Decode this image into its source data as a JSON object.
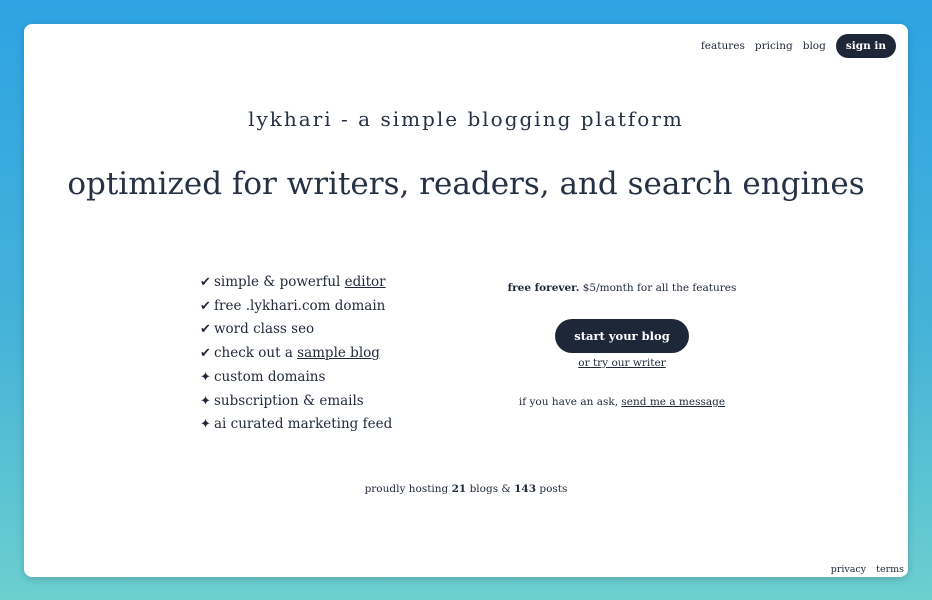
{
  "nav": {
    "items": [
      "features",
      "pricing",
      "blog"
    ],
    "signin_label": "sign in"
  },
  "hero": {
    "site_title": "lykhari - a simple blogging platform",
    "tagline": "optimized for writers, readers, and search engines"
  },
  "features": {
    "check_mark": "✔",
    "star_mark": "✦",
    "items": [
      {
        "text": "simple & powerful ",
        "link": "editor"
      },
      {
        "text": "free .lykhari.com domain"
      },
      {
        "text": "word class seo"
      },
      {
        "text": "check out a ",
        "link": "sample blog"
      },
      {
        "text": "custom domains"
      },
      {
        "text": "subscription & emails"
      },
      {
        "text": "ai curated marketing feed"
      }
    ]
  },
  "cta": {
    "pricing_bold": "free forever.",
    "pricing_rest": " $5/month for all the features",
    "start_button": "start your blog",
    "try_writer": "or try our writer",
    "ask_prefix": "if you have an ask, ",
    "ask_link": "send me a message"
  },
  "stats": {
    "prefix": "proudly hosting ",
    "blogs": "21",
    "middle": " blogs & ",
    "posts": "143",
    "suffix": " posts"
  },
  "footer": {
    "privacy": "privacy",
    "terms": "terms"
  },
  "colors": {
    "accent_dark": "#1e2738",
    "background_top": "#2ea3e3",
    "background_bottom": "#6ccfcf"
  }
}
